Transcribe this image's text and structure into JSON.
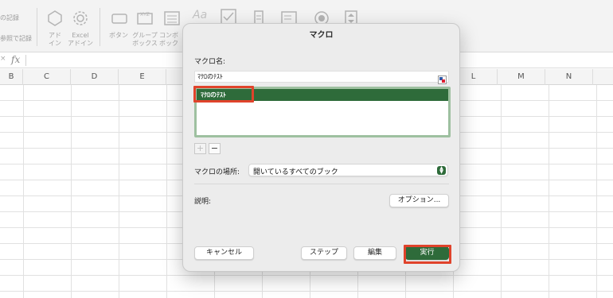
{
  "ribbon": {
    "record_macro": "の記録",
    "relative_ref": "参照で記録",
    "addins_label_1": "アド",
    "addins_label_2": "イン",
    "excel_addins_1": "Excel",
    "excel_addins_2": "アドイン",
    "button_label": "ボタン",
    "groupbox_1": "グループ",
    "groupbox_2": "ボックス",
    "combo_1": "コンボ",
    "combo_2": "ボック",
    "label_icon_text": "Aa"
  },
  "formula_bar": {
    "fx": "fx"
  },
  "columns": {
    "b": "B",
    "c": "C",
    "d": "D",
    "e": "E",
    "l": "L",
    "m": "M",
    "n": "N"
  },
  "dialog": {
    "title": "マクロ",
    "name_label": "マクロ名:",
    "name_value": "ﾏｸﾛのﾃｽﾄ",
    "list_items": [
      "ﾏｸﾛのﾃｽﾄ"
    ],
    "add_symbol": "+",
    "remove_symbol": "−",
    "location_label": "マクロの場所:",
    "location_value": "開いているすべてのブック",
    "description_label": "説明:",
    "options_button": "オプション...",
    "cancel_button": "キャンセル",
    "step_button": "ステップ",
    "edit_button": "編集",
    "run_button": "実行"
  },
  "colors": {
    "accent": "#2e6b3a",
    "highlight": "#e0432b"
  },
  "icons": [
    "addin-icon",
    "gear-icon",
    "button-control-icon",
    "groupbox-icon",
    "listbox-icon",
    "label-icon",
    "checkbox-icon",
    "scrollbar-icon",
    "option-button-icon",
    "spin-button-icon",
    "macro-name-picker-icon",
    "stepper-icon"
  ]
}
